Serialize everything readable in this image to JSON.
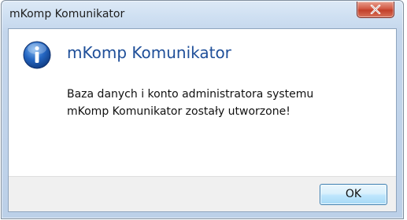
{
  "window": {
    "title": "mKomp Komunikator"
  },
  "dialog": {
    "icon": "info-icon",
    "heading": "mKomp Komunikator",
    "message_line1": "Baza danych i konto administratora systemu",
    "message_line2": "mKomp Komunikator zostały utworzone!"
  },
  "buttons": {
    "ok_label": "OK",
    "close_icon": "close-icon"
  },
  "colors": {
    "heading": "#1f4f99",
    "close_button": "#c2402a",
    "footer": "#f0f0f0"
  }
}
